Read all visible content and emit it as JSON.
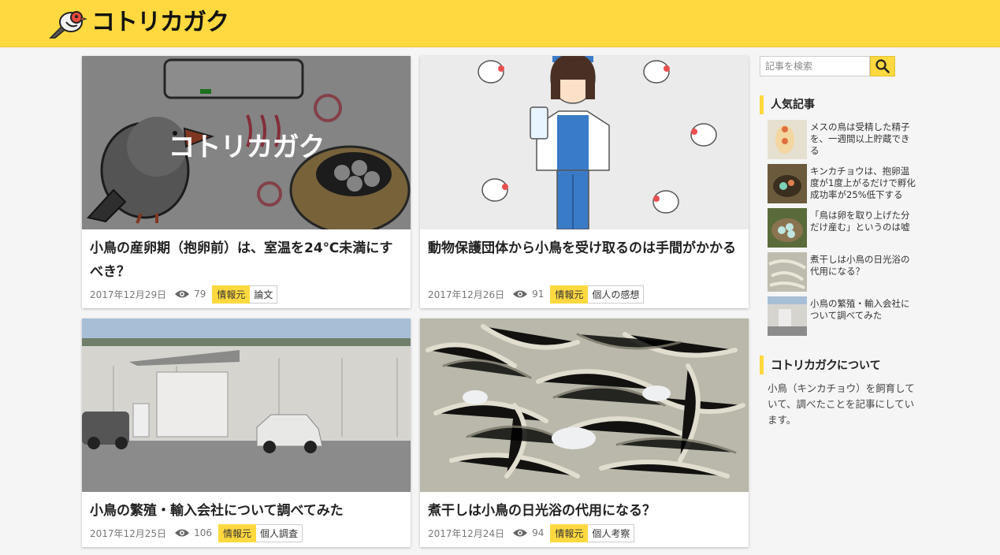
{
  "site": {
    "logo_text": "コトリカガク"
  },
  "search": {
    "placeholder": "記事を検索"
  },
  "cards": [
    {
      "title": "小鳥の産卵期（抱卵前）は、室温を24℃未満にすべき？",
      "date": "2017年12月29日",
      "views": "79",
      "source_tag": "情報元",
      "type_tag": "論文",
      "thumb_overlay_text": "コトリカガク"
    },
    {
      "title": "動物保護団体から小鳥を受け取るのは手間がかかる",
      "date": "2017年12月26日",
      "views": "91",
      "source_tag": "情報元",
      "type_tag": "個人の感想"
    },
    {
      "title": "小鳥の繁殖・輸入会社について調べてみた",
      "date": "2017年12月25日",
      "views": "106",
      "source_tag": "情報元",
      "type_tag": "個人調査"
    },
    {
      "title": "煮干しは小鳥の日光浴の代用になる？",
      "date": "2017年12月24日",
      "views": "94",
      "source_tag": "情報元",
      "type_tag": "個人考察"
    }
  ],
  "sidebar": {
    "popular_heading": "人気記事",
    "popular": [
      {
        "title": "メスの鳥は受精した精子を、一週間以上貯蔵できる"
      },
      {
        "title": "キンカチョウは、抱卵温度が1度上がるだけで孵化成功率が25%低下する"
      },
      {
        "title": "「鳥は卵を取り上げた分だけ産む」というのは嘘"
      },
      {
        "title": "煮干しは小鳥の日光浴の代用になる？"
      },
      {
        "title": "小鳥の繁殖・輸入会社について調べてみた"
      }
    ],
    "about_heading_logo": "コトリカガク",
    "about_heading_suffix": "について",
    "about_text": "小鳥（キンカチョウ）を飼育していて、調べたことを記事にしています。"
  },
  "colors": {
    "accent": "#ffd93f",
    "background": "#f5f5f5"
  }
}
